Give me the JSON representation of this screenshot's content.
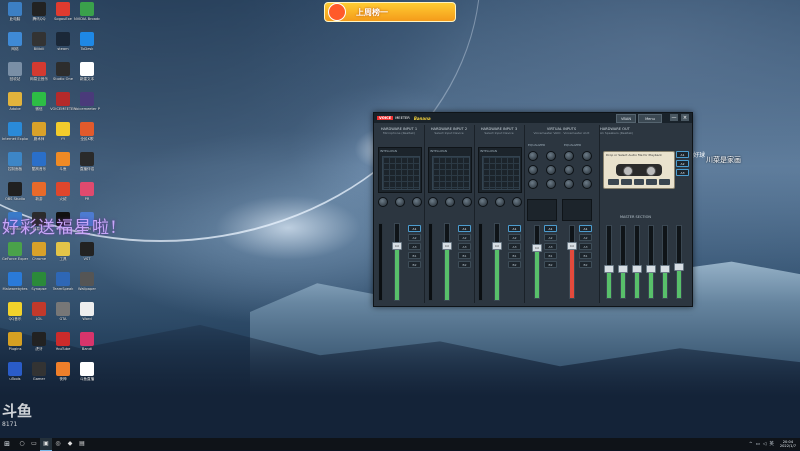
{
  "top_ad": {
    "text": "上周榜一"
  },
  "overlay": {
    "text": "好彩送福星啦!"
  },
  "watermark": {
    "logo": "斗鱼",
    "number": "8171"
  },
  "side_text": {
    "a": "川菜是家画",
    "b": "FREE 好球"
  },
  "desktop_icons": [
    {
      "label": "此电脑",
      "icon": "computer-icon",
      "color": "#3c7fc4"
    },
    {
      "label": "腾讯QQ",
      "icon": "qq-icon",
      "color": "#222222"
    },
    {
      "label": "SogouExe",
      "icon": "sogou-icon",
      "color": "#e03b2f"
    },
    {
      "label": "NVIDIA Broadcast",
      "icon": "nvidia-icon",
      "color": "#3aa14b"
    },
    {
      "label": "网络",
      "icon": "network-icon",
      "color": "#3f8ad6"
    },
    {
      "label": "Bilibili",
      "icon": "bilibili-icon",
      "color": "#333333"
    },
    {
      "label": "steam",
      "icon": "steam-icon",
      "color": "#1b2838"
    },
    {
      "label": "ToDesk",
      "icon": "todesk-icon",
      "color": "#1e88e5"
    },
    {
      "label": "回收站",
      "icon": "recycle-bin-icon",
      "color": "#7a8fa6"
    },
    {
      "label": "网易云音乐",
      "icon": "netease-music-icon",
      "color": "#d33a31"
    },
    {
      "label": "Studio One",
      "icon": "studio-one-icon",
      "color": "#2d2d2d"
    },
    {
      "label": "新建文本",
      "icon": "text-file-icon",
      "color": "#ffffff"
    },
    {
      "label": "Adobe",
      "icon": "folder-icon",
      "color": "#e2b33c"
    },
    {
      "label": "微信",
      "icon": "wechat-icon",
      "color": "#2dbd45"
    },
    {
      "label": "VOICEMEETER",
      "icon": "voicemeeter-icon",
      "color": "#b52a2a"
    },
    {
      "label": "Voicemeeter Potato",
      "icon": "voicemeeter-potato-icon",
      "color": "#4a3a7a"
    },
    {
      "label": "Internet Explorer",
      "icon": "ie-icon",
      "color": "#2a8ad8"
    },
    {
      "label": "魔术师",
      "icon": "app-icon",
      "color": "#d9a129"
    },
    {
      "label": "YY",
      "icon": "yy-icon",
      "color": "#f3cc2c"
    },
    {
      "label": "全民K歌",
      "icon": "karaoke-icon",
      "color": "#e25a2c"
    },
    {
      "label": "控制面板",
      "icon": "control-panel-icon",
      "color": "#3d86c6"
    },
    {
      "label": "酷狗音乐",
      "icon": "kugou-icon",
      "color": "#2a6fc9"
    },
    {
      "label": "斗鱼",
      "icon": "douyu-icon",
      "color": "#f08a24"
    },
    {
      "label": "直播伴侣",
      "icon": "live-icon",
      "color": "#2a2a2a"
    },
    {
      "label": "OBS Studio",
      "icon": "obs-icon",
      "color": "#202020"
    },
    {
      "label": "新游",
      "icon": "game-icon",
      "color": "#e86a2a"
    },
    {
      "label": "火绒",
      "icon": "huorong-icon",
      "color": "#e0462c"
    },
    {
      "label": "PR",
      "icon": "pr-icon",
      "color": "#e04a6e"
    },
    {
      "label": "Everything",
      "icon": "search-app-icon",
      "color": "#3a7ac8"
    },
    {
      "label": "网易UU",
      "icon": "uu-icon",
      "color": "#2b2b2b"
    },
    {
      "label": "CapCut",
      "icon": "capcut-icon",
      "color": "#111111"
    },
    {
      "label": "Intel",
      "icon": "intel-icon",
      "color": "#4d7bd0"
    },
    {
      "label": "GeForce Experience",
      "icon": "geforce-icon",
      "color": "#4aa24a"
    },
    {
      "label": "Chrome",
      "icon": "chrome-icon",
      "color": "#d8a12a"
    },
    {
      "label": "工具",
      "icon": "tools-icon",
      "color": "#e3c448"
    },
    {
      "label": "VST",
      "icon": "vst-icon",
      "color": "#222222"
    },
    {
      "label": "Malwarebytes",
      "icon": "malwarebytes-icon",
      "color": "#2a7ad8"
    },
    {
      "label": "Synapse",
      "icon": "synapse-icon",
      "color": "#2b8a3a"
    },
    {
      "label": "TeamSpeak",
      "icon": "teamspeak-icon",
      "color": "#2e67b6"
    },
    {
      "label": "Wallpaper",
      "icon": "wallpaper-icon",
      "color": "#555555"
    },
    {
      "label": "QQ音乐",
      "icon": "qq-music-icon",
      "color": "#f2d22b"
    },
    {
      "label": "LOL",
      "icon": "lol-icon",
      "color": "#c1392b"
    },
    {
      "label": "GTA",
      "icon": "gta-icon",
      "color": "#777777"
    },
    {
      "label": "Word",
      "icon": "word-icon",
      "color": "#eeeeee"
    },
    {
      "label": "Plugins",
      "icon": "plugin-icon",
      "color": "#d6a022"
    },
    {
      "label": "虎牙",
      "icon": "huya-icon",
      "color": "#222222"
    },
    {
      "label": "YouTube",
      "icon": "youtube-icon",
      "color": "#cc2b2b"
    },
    {
      "label": "Bandi",
      "icon": "bandicam-icon",
      "color": "#d8346b"
    },
    {
      "label": "uTools",
      "icon": "utools-icon",
      "color": "#2a5cc8"
    },
    {
      "label": "Gamer",
      "icon": "gamer-icon",
      "color": "#333333"
    },
    {
      "label": "夜神",
      "icon": "nox-icon",
      "color": "#ef7f2a"
    },
    {
      "label": "斗鱼直播",
      "icon": "douyu-live-icon",
      "color": "#ffffff"
    }
  ],
  "voicemeeter": {
    "brand": "VOICE",
    "brand2": "MEETER",
    "edition": "Banana",
    "vban_label": "VBAN",
    "menu_label": "Menu",
    "minimize": "—",
    "close": "×",
    "strips": [
      {
        "title": "HARDWARE INPUT 1",
        "sub": "Microphone (Realtek)"
      },
      {
        "title": "HARDWARE INPUT 2",
        "sub": "Select Input Device"
      },
      {
        "title": "HARDWARE INPUT 3",
        "sub": "Select Input Device"
      }
    ],
    "virtual": {
      "title": "VIRTUAL INPUTS",
      "a": "Voicemeeter VAIO",
      "b": "Voicemeeter AUX",
      "eq": "EQUALIZER"
    },
    "intellipan": "INTELLIPAN",
    "voice_label": "Color Panel",
    "bus_buttons": [
      "A1",
      "A2",
      "A3",
      "B1",
      "B2"
    ],
    "fader_label": "0.0",
    "hw_out": {
      "title": "HARDWARE OUT",
      "sub": "A1 Speakers (Realtek)",
      "cassette": "Drop or Select Audio file for Playback",
      "master": "MASTER SECTION"
    },
    "out_buttons": [
      "A1",
      "A2",
      "A3"
    ],
    "channel_levels": [
      0.42,
      0.42,
      0.42,
      0.42,
      0.42,
      0.45
    ]
  },
  "taskbar": {
    "start": "⊞",
    "apps": [
      {
        "icon": "search-icon",
        "glyph": "○"
      },
      {
        "icon": "task-view-icon",
        "glyph": "▭"
      },
      {
        "icon": "voicemeeter-taskbar-icon",
        "glyph": "▣"
      },
      {
        "icon": "steam-taskbar-icon",
        "glyph": "◎"
      },
      {
        "icon": "app-taskbar-icon",
        "glyph": "◆"
      },
      {
        "icon": "explorer-taskbar-icon",
        "glyph": "▤"
      }
    ],
    "time": "20:04",
    "date": "2022/1/7"
  }
}
